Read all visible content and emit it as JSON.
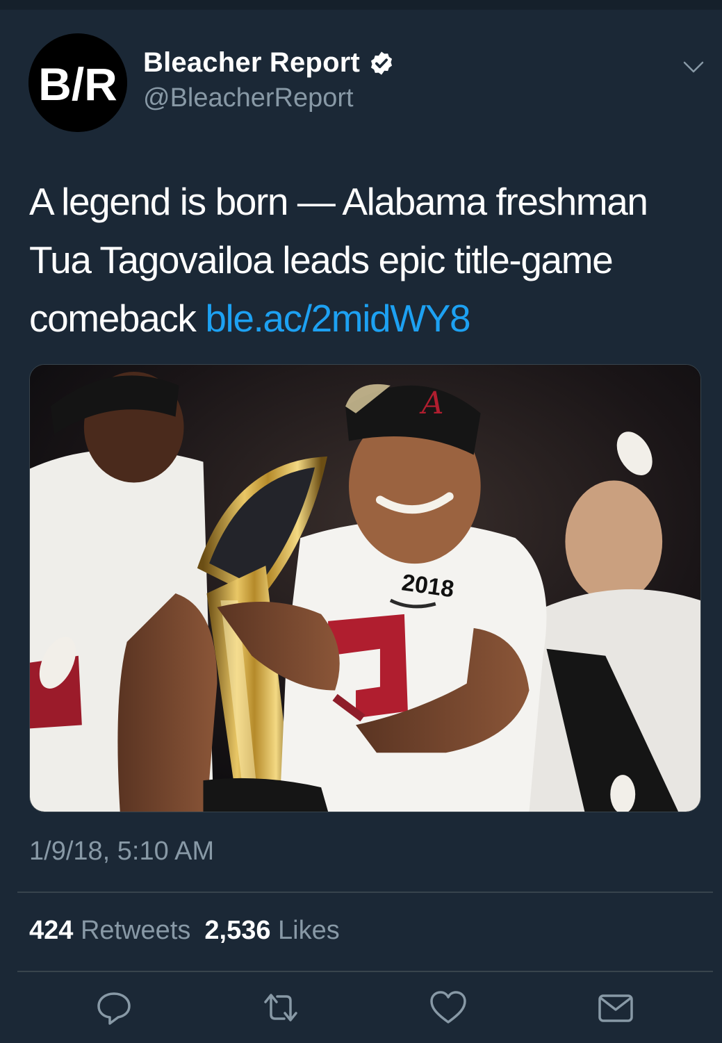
{
  "account": {
    "name": "Bleacher Report",
    "handle": "@BleacherReport",
    "avatar_text": "B/R",
    "verified": true,
    "icons": {
      "verified": "verified-badge-icon",
      "more": "chevron-down-icon"
    }
  },
  "tweet": {
    "text": "A legend is born — Alabama freshman Tua Tagovailoa leads epic title-game comeback ",
    "link": "ble.ac/2midWY8",
    "timestamp": "1/9/18, 5:10 AM",
    "media": {
      "jersey_text": "2018",
      "patch_text": "2018"
    }
  },
  "stats": {
    "retweets_count": "424",
    "retweets_label": "Retweets",
    "likes_count": "2,536",
    "likes_label": "Likes"
  },
  "actions": [
    "reply-icon",
    "retweet-icon",
    "like-icon",
    "direct-message-icon"
  ],
  "colors": {
    "background": "#1b2836",
    "text": "#ffffff",
    "secondary": "#8899a6",
    "link": "#1da1f2",
    "divider": "#38444d"
  }
}
